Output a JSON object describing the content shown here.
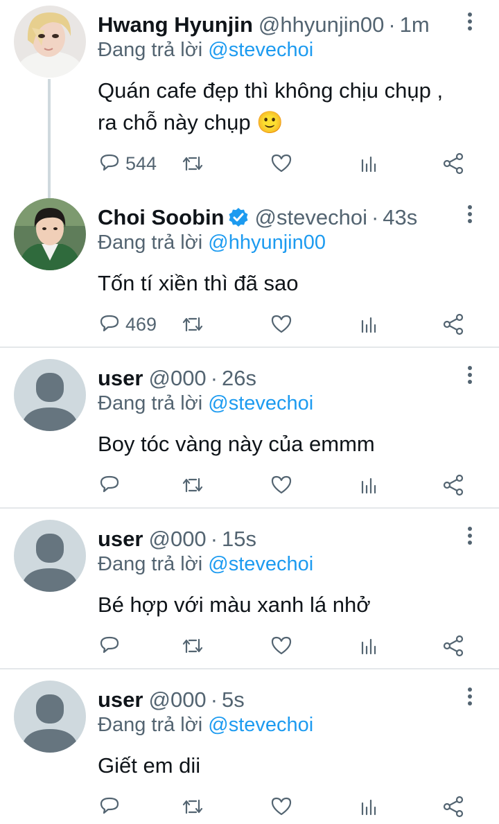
{
  "tweets": [
    {
      "name": "Hwang Hyunjin",
      "handle": "@hhyunjin00",
      "separator": "·",
      "time": "1m",
      "replying_prefix": "Đang trả lời ",
      "replying_to": "@stevechoi",
      "text": "Quán cafe đẹp thì không chịu chụp ,\nra chỗ này chụp 🙂",
      "reply_count": "544",
      "verified": false,
      "avatar_icon": "photo-avatar-blonde"
    },
    {
      "name": "Choi Soobin",
      "handle": "@stevechoi",
      "separator": "·",
      "time": "43s",
      "replying_prefix": "Đang trả lời ",
      "replying_to": "@hhyunjin00",
      "text": "Tốn tí xiền thì đã sao",
      "reply_count": "469",
      "verified": true,
      "avatar_icon": "photo-avatar-green-jacket"
    },
    {
      "name": "user",
      "handle": "@000",
      "separator": "·",
      "time": "26s",
      "replying_prefix": "Đang trả lời ",
      "replying_to": "@stevechoi",
      "text": "Boy tóc vàng này của emmm",
      "reply_count": "",
      "verified": false,
      "avatar_icon": "default-avatar"
    },
    {
      "name": "user",
      "handle": "@000",
      "separator": "·",
      "time": "15s",
      "replying_prefix": "Đang trả lời ",
      "replying_to": "@stevechoi",
      "text": "Bé hợp với màu xanh lá nhở",
      "reply_count": "",
      "verified": false,
      "avatar_icon": "default-avatar"
    },
    {
      "name": "user",
      "handle": "@000",
      "separator": "·",
      "time": "5s",
      "replying_prefix": "Đang trả lời ",
      "replying_to": "@stevechoi",
      "text": "Giết em dii",
      "reply_count": "",
      "verified": false,
      "avatar_icon": "default-avatar"
    }
  ],
  "colors": {
    "accent": "#1d9bf0",
    "secondary_text": "#536471",
    "primary_text": "#0f1419",
    "divider": "#e4e7ea",
    "default_avatar_bg": "#cfd9de",
    "default_avatar_fg": "#66757f"
  }
}
